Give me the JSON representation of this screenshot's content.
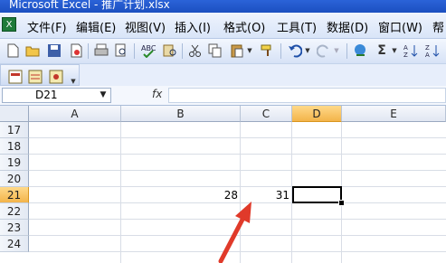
{
  "window": {
    "title": "Microsoft Excel - 推广计划.xlsx"
  },
  "menu": [
    {
      "label": "文件(F)"
    },
    {
      "label": "编辑(E)"
    },
    {
      "label": "视图(V)"
    },
    {
      "label": "插入(I)"
    },
    {
      "label": "格式(O)"
    },
    {
      "label": "工具(T)"
    },
    {
      "label": "数据(D)"
    },
    {
      "label": "窗口(W)"
    },
    {
      "label": "帮"
    }
  ],
  "formula_bar": {
    "cell_ref": "D21",
    "fx": "fx",
    "formula": ""
  },
  "columns": [
    "A",
    "B",
    "C",
    "D",
    "E"
  ],
  "selected_column": "D",
  "rows": [
    "17",
    "18",
    "19",
    "20",
    "21",
    "22",
    "23",
    "24"
  ],
  "selected_row": "21",
  "cells": {
    "B21": "28",
    "C21": "31"
  },
  "toolbar": {
    "sigma": "Σ"
  },
  "colors": {
    "title_bar": "#1b4fc0",
    "selection_header": "#f3b44a",
    "annotation_arrow": "#e03a2a"
  }
}
